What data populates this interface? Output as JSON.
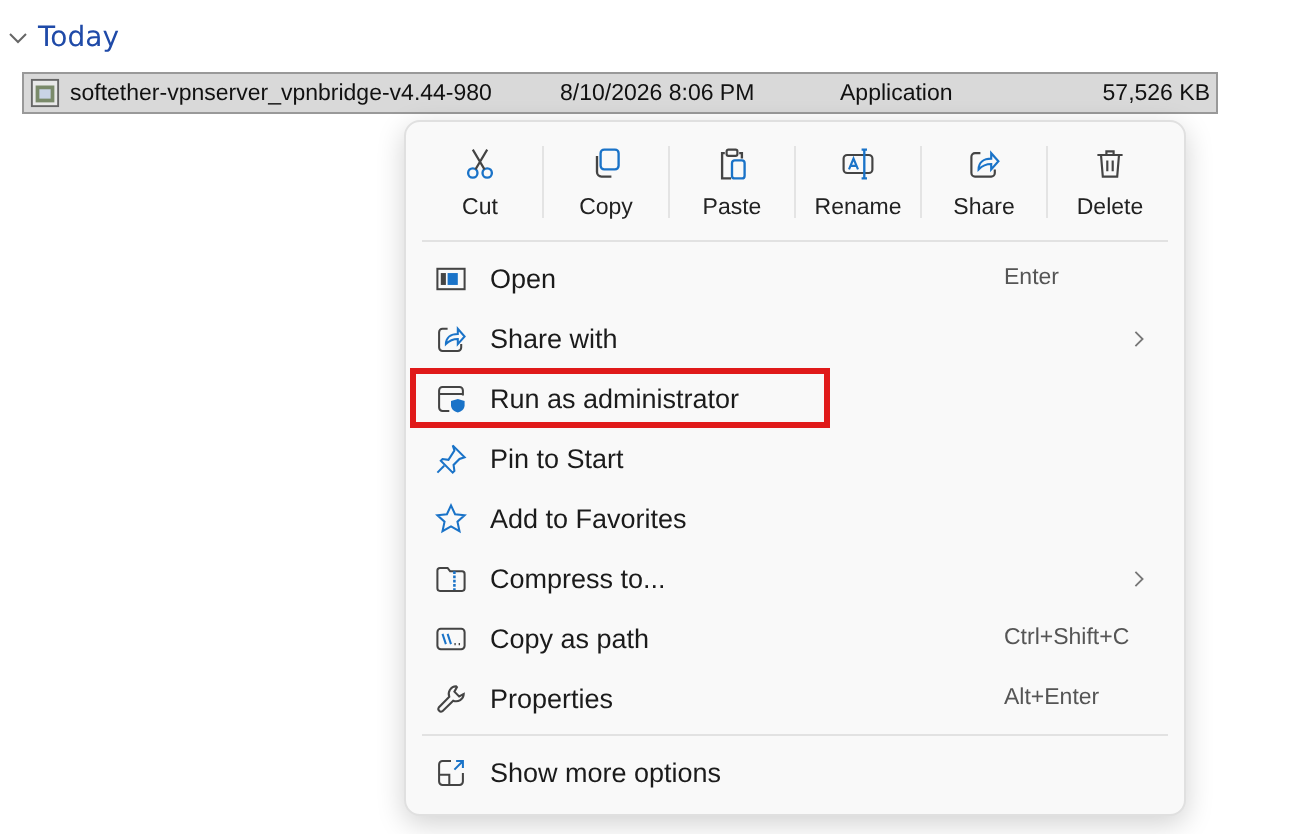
{
  "group": {
    "label": "Today",
    "expanded": true
  },
  "file_row": {
    "selected": true,
    "name": "softether-vpnserver_vpnbridge-v4.44-980",
    "date": "8/10/2026 8:06 PM",
    "type": "Application",
    "size": "57,526 KB"
  },
  "context_menu": {
    "actions": [
      {
        "kind": "cut",
        "label": "Cut"
      },
      {
        "kind": "copy",
        "label": "Copy"
      },
      {
        "kind": "paste",
        "label": "Paste"
      },
      {
        "kind": "rename",
        "label": "Rename"
      },
      {
        "kind": "share",
        "label": "Share"
      },
      {
        "kind": "delete",
        "label": "Delete"
      }
    ],
    "items": [
      {
        "kind": "open",
        "label": "Open",
        "shortcut": "Enter",
        "submenu": false,
        "highlighted": false
      },
      {
        "kind": "share",
        "label": "Share with",
        "submenu": true,
        "highlighted": false
      },
      {
        "kind": "admin",
        "label": "Run as administrator",
        "submenu": false,
        "highlighted": true
      },
      {
        "kind": "pin",
        "label": "Pin to Start",
        "submenu": false,
        "highlighted": false
      },
      {
        "kind": "star",
        "label": "Add to Favorites",
        "submenu": false,
        "highlighted": false
      },
      {
        "kind": "zip",
        "label": "Compress to...",
        "submenu": true,
        "highlighted": false
      },
      {
        "kind": "path",
        "label": "Copy as path",
        "shortcut": "Ctrl+Shift+C",
        "submenu": false,
        "highlighted": false
      },
      {
        "kind": "wrench",
        "label": "Properties",
        "shortcut": "Alt+Enter",
        "submenu": false,
        "highlighted": false
      }
    ],
    "footer": {
      "kind": "more",
      "label": "Show more options"
    }
  }
}
